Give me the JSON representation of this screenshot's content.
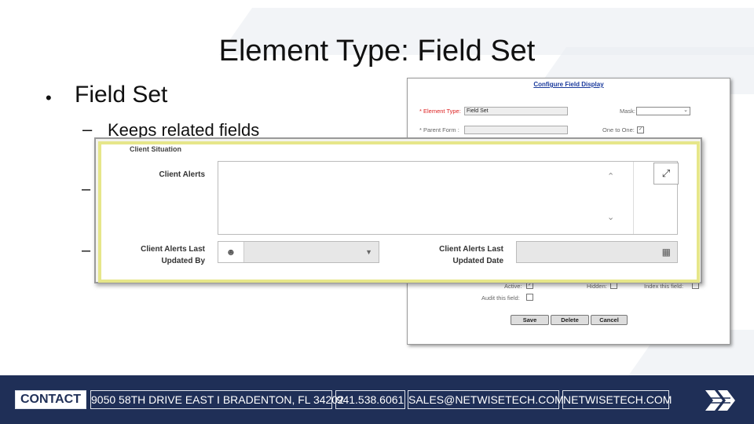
{
  "slide": {
    "title": "Element Type: Field Set",
    "bullet": "Field Set",
    "subbullet": "Keeps related fields",
    "dash2": "–",
    "dash3": "–"
  },
  "config_dialog": {
    "title": "Configure Field Display",
    "element_type_label": "* Element Type:",
    "element_type_value": "Field Set",
    "mask_label": "Mask:",
    "parent_form_label": "* Parent Form :",
    "one_to_one_label": "One to One:",
    "one_to_one_checked": "✓",
    "active_label": "Active:",
    "active_checked": "✓",
    "hidden_label": "Hidden:",
    "index_label": "Index this field:",
    "audit_label": "Audit this field:",
    "buttons": [
      "Save",
      "Delete",
      "Cancel"
    ]
  },
  "client_panel": {
    "title": "Client Situation",
    "alerts_label": "Client Alerts",
    "last_updated_by_label_1": "Client Alerts Last",
    "last_updated_by_label_2": "Updated By",
    "last_updated_date_label_1": "Client Alerts Last",
    "last_updated_date_label_2": "Updated Date"
  },
  "footer": {
    "contact": "CONTACT",
    "address": "9050 58TH DRIVE EAST I BRADENTON, FL 34202",
    "phone": "941.538.6061",
    "email": "SALES@NETWISETECH.COM",
    "website": "NETWISETECH.COM"
  },
  "colors": {
    "footer_bg": "#1f2f57",
    "panel_highlight": "#e6e68a",
    "link_blue": "#1a3a9c"
  },
  "icons": {
    "expand": "expand-icon",
    "user": "user-icon",
    "calendar": "calendar-icon",
    "caret": "caret-down-icon",
    "logo": "chevron-logo-icon"
  }
}
